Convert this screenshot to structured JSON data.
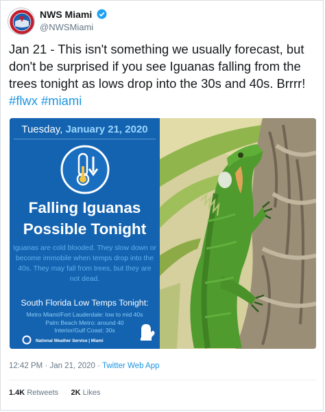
{
  "user": {
    "name": "NWS Miami",
    "handle": "@NWSMiami",
    "brand_color": "#1b95e0"
  },
  "tweet": {
    "text": "Jan 21 - This isn't something we usually forecast, but don't be surprised if you see Iguanas falling from the trees tonight as lows drop into the 30s and 40s. Brrrr!",
    "hashtags": [
      "#flwx",
      "#miami"
    ]
  },
  "card": {
    "day": "Tuesday,",
    "date": "January 21, 2020",
    "headline_line1": "Falling Iguanas",
    "headline_line2": "Possible Tonight",
    "body": "Iguanas are cold blooded. They slow down or become immobile when temps drop into the 40s. They may fall from trees, but they are not dead.",
    "low_title": "South Florida Low Temps Tonight:",
    "lows": [
      "Metro Miami/Fort Lauderdale: low to mid 40s",
      "Palm Beach Metro: around 40",
      "Interior/Gulf Coast: 30s"
    ],
    "footer": "National Weather Service | Miami",
    "icons": [
      "thermometer-icon",
      "down-arrow-icon",
      "mitten-icon",
      "nws-logo-icon"
    ]
  },
  "meta": {
    "time": "12:42 PM · Jan 21, 2020 · ",
    "app": "Twitter Web App"
  },
  "stats": {
    "retweets_count": "1.4K",
    "retweets_label": "Retweets",
    "likes_count": "2K",
    "likes_label": "Likes"
  }
}
